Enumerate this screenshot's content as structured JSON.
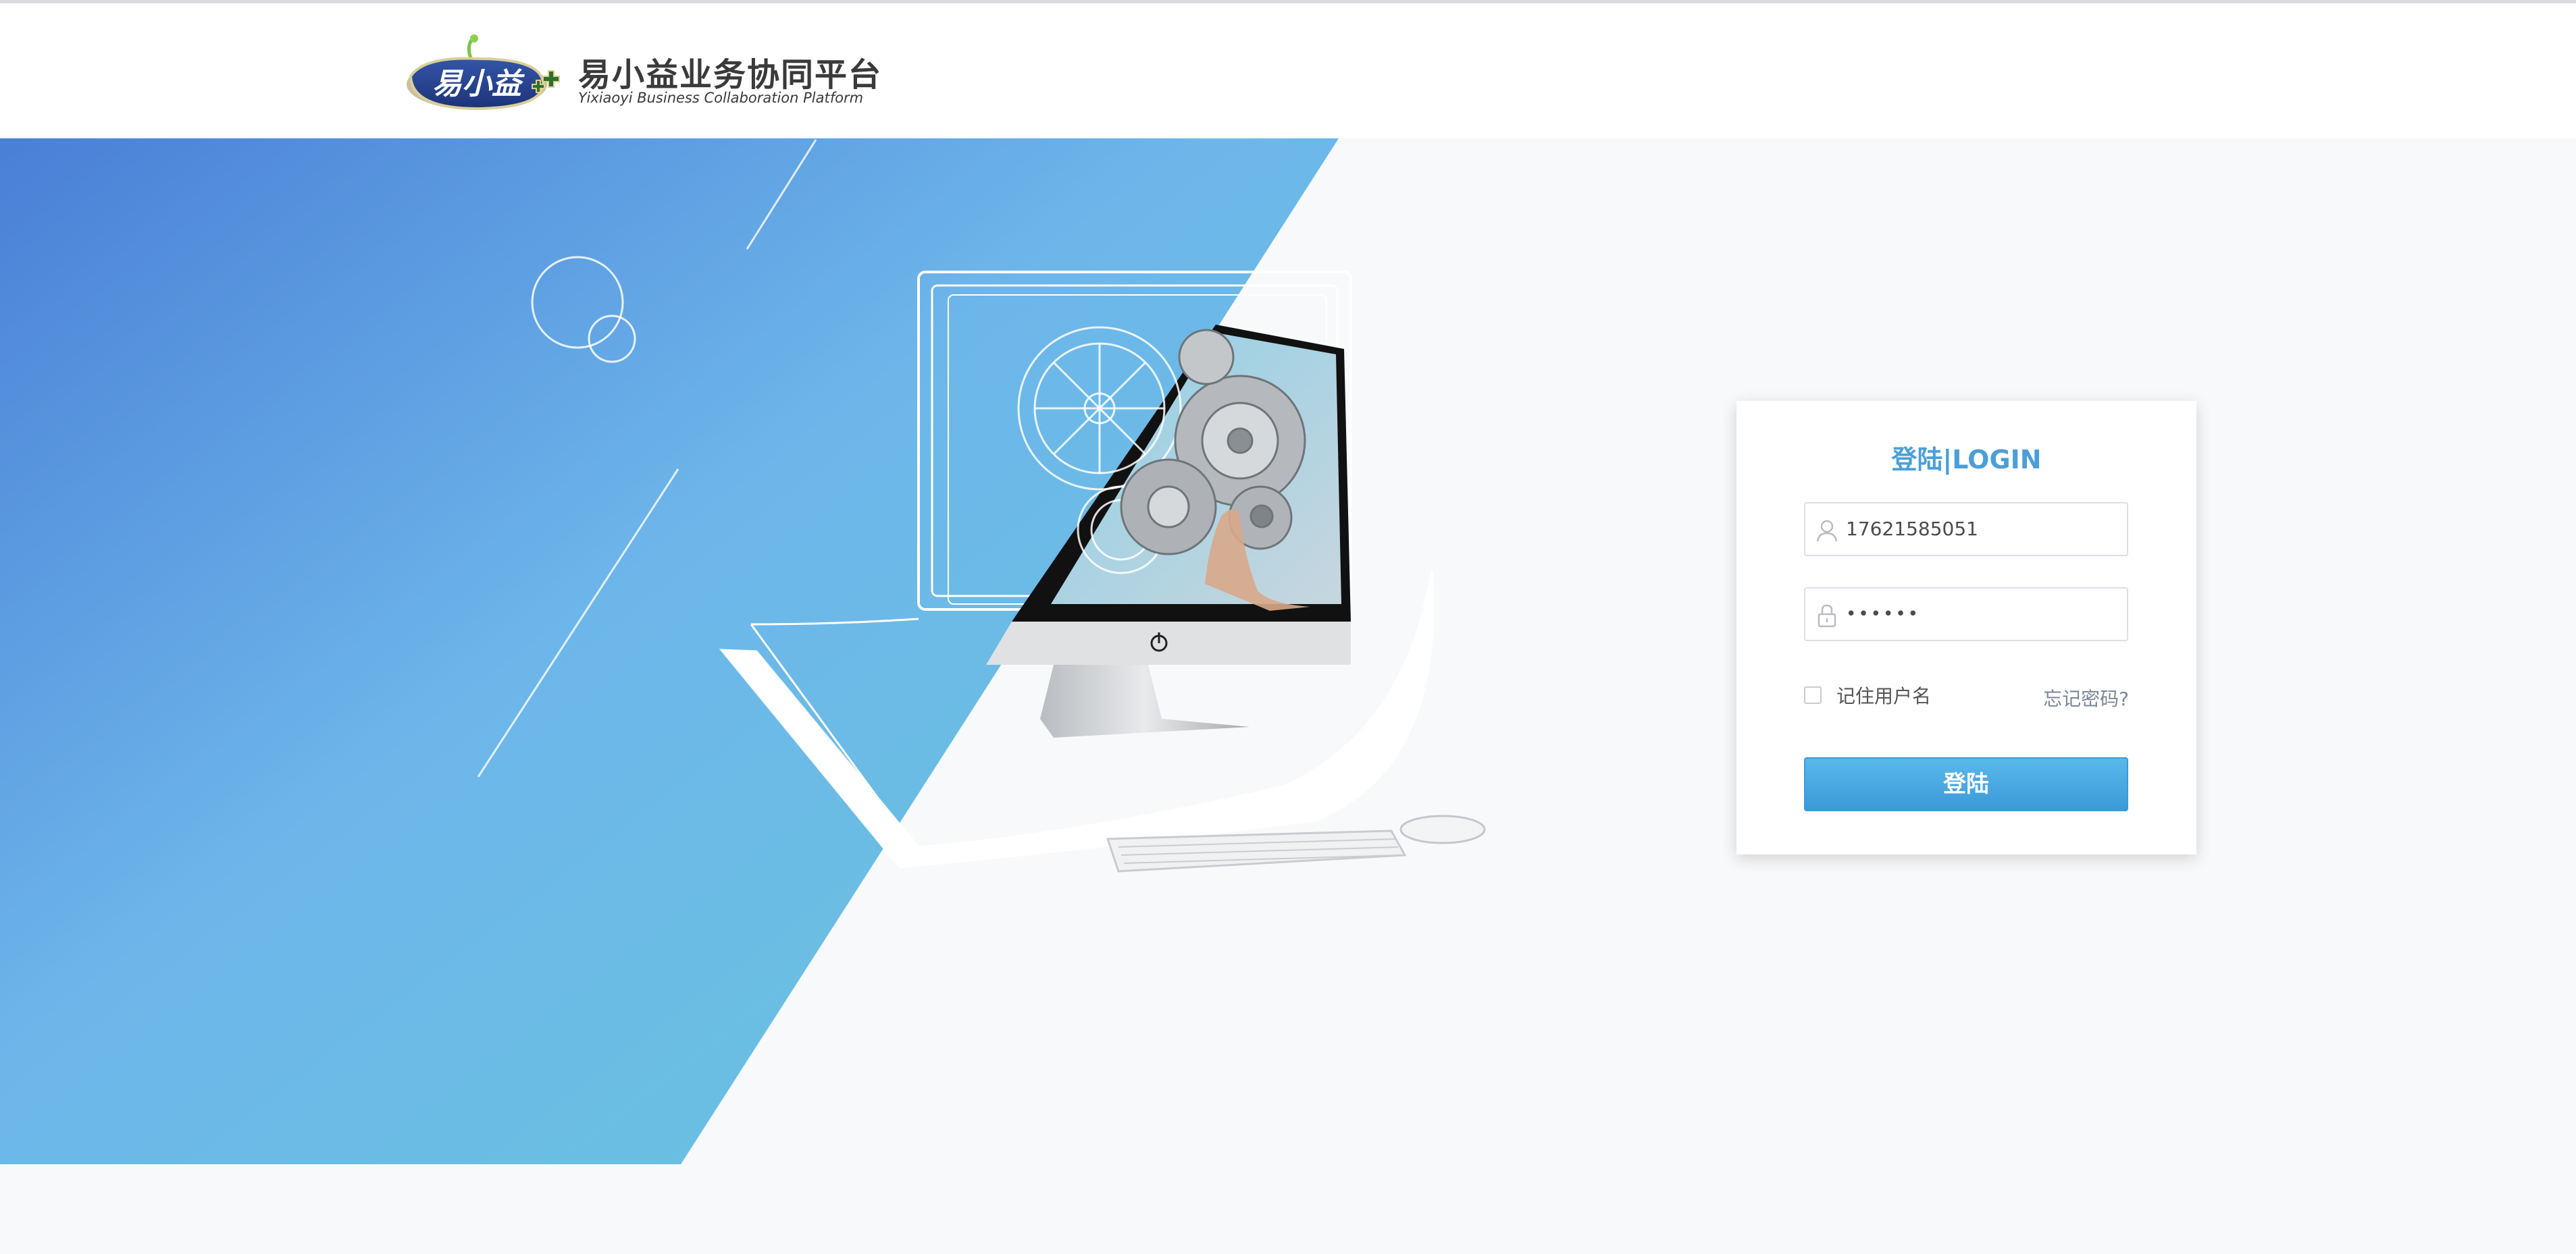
{
  "header": {
    "title": "易小益业务协同平台",
    "subtitle": "Yixiaoyi Business Collaboration Platform",
    "logo_text": "易小益"
  },
  "login": {
    "title": "登陆|LOGIN",
    "username_value": "17621585051",
    "password_masked": "••••••",
    "remember_label": "记住用户名",
    "forgot_label": "忘记密码?",
    "submit_label": "登陆"
  },
  "colors": {
    "accent": "#4a9fd8",
    "button": "#3a9ad8",
    "hero_gradient_start": "#4a7fd6",
    "hero_gradient_end": "#68c6dc"
  },
  "icons": {
    "username": "user-icon",
    "password": "lock-icon"
  }
}
